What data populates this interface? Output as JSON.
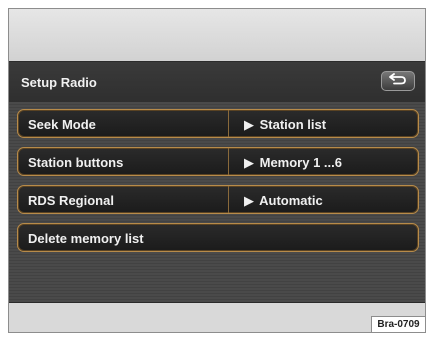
{
  "screen": {
    "title": "Setup Radio",
    "back_icon": "back-arrow-icon"
  },
  "rows": [
    {
      "label": "Seek Mode",
      "value": "Station list"
    },
    {
      "label": "Station buttons",
      "value": "Memory 1 ...6"
    },
    {
      "label": "RDS Regional",
      "value": "Automatic"
    },
    {
      "label": "Delete memory list"
    }
  ],
  "figure_code": "Bra-0709",
  "colors": {
    "row_border": "#b78b4a",
    "background": "#424242",
    "text": "#f0f0f0"
  }
}
